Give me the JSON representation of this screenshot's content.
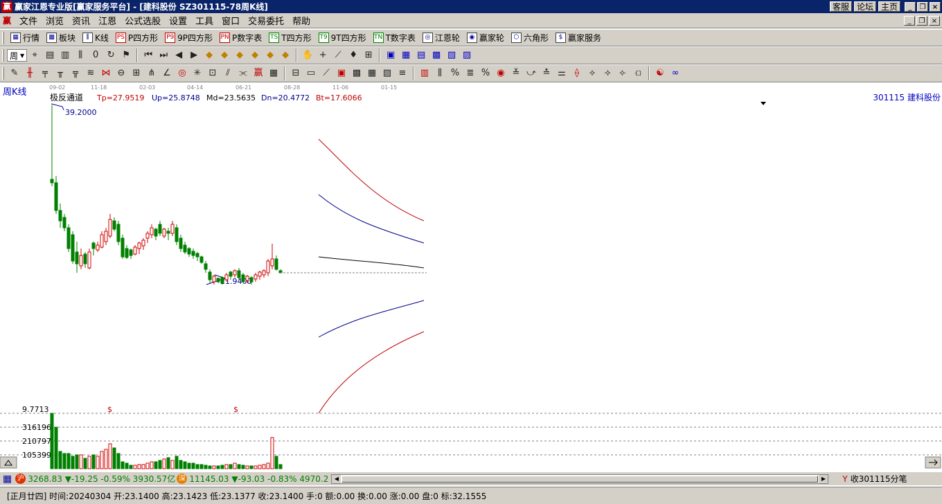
{
  "window": {
    "title": "赢家江恩专业版[赢家服务平台] - [建科股份  SZ301115-78周K线]",
    "logo": "赢",
    "links": [
      "客服",
      "论坛",
      "主页"
    ]
  },
  "menu": {
    "logo": "赢",
    "items": [
      "文件",
      "浏览",
      "资讯",
      "江恩",
      "公式选股",
      "设置",
      "工具",
      "窗口",
      "交易委托",
      "帮助"
    ]
  },
  "toolbar1": {
    "items": [
      {
        "icon": "grid-icon",
        "glyph": "▦",
        "label": "行情"
      },
      {
        "icon": "blocks-icon",
        "glyph": "▩",
        "label": "板块"
      },
      {
        "icon": "kline-icon",
        "glyph": "⫼",
        "label": "K线"
      },
      {
        "icon": "ps-icon",
        "glyph": "PS",
        "label": "P四方形"
      },
      {
        "icon": "p9-icon",
        "glyph": "P9",
        "label": "9P四方形"
      },
      {
        "icon": "pn-icon",
        "glyph": "PN",
        "label": "P数字表"
      },
      {
        "icon": "ts-icon",
        "glyph": "TS",
        "label": "T四方形"
      },
      {
        "icon": "t9-icon",
        "glyph": "T9",
        "label": "9T四方形"
      },
      {
        "icon": "tn-icon",
        "glyph": "TN",
        "label": "T数字表"
      },
      {
        "icon": "gann-wheel-icon",
        "glyph": "◎",
        "label": "江恩轮"
      },
      {
        "icon": "winner-wheel-icon",
        "glyph": "◉",
        "label": "赢家轮"
      },
      {
        "icon": "hexagon-icon",
        "glyph": "⬡",
        "label": "六角形"
      },
      {
        "icon": "dollar-icon",
        "glyph": "$",
        "label": "赢家服务"
      }
    ]
  },
  "toolbar2": {
    "period": "周",
    "icons": [
      "cursor-icon",
      "table-icon",
      "bars-icon",
      "candles-icon",
      "zero-icon",
      "rotate-icon",
      "flag-icon",
      "first-icon",
      "last-icon",
      "left-icon",
      "right-icon",
      "diamond1-icon",
      "diamond2-icon",
      "diamond3-icon",
      "diamond4-icon",
      "diamond5-icon",
      "diamond6-icon",
      "hand-icon",
      "cross-icon",
      "zigzag-icon",
      "gift-icon",
      "overlay-icon",
      "calendar-icon",
      "calc-icon",
      "doc-icon",
      "save-icon",
      "print-icon",
      "export-icon"
    ]
  },
  "toolbar3": {
    "icons": [
      "pen-icon",
      "line1-icon",
      "line2-icon",
      "line3-icon",
      "line4-icon",
      "line5-icon",
      "line6-icon",
      "circle-icon",
      "hline-icon",
      "fan-icon",
      "angle-icon",
      "spiral-icon",
      "star-icon",
      "box-icon",
      "channel-icon",
      "gann-fan-icon",
      "winner-icon",
      "grid2-icon",
      "grid3-icon",
      "rect-icon",
      "fan2-icon",
      "box2-icon",
      "box3-icon",
      "grid4-icon",
      "hatch-icon",
      "lines-icon",
      "bars2-icon",
      "fib-icon",
      "percent-icon",
      "fib2-icon",
      "pct2-icon",
      "circle2-icon",
      "fib3-icon",
      "arrow-icon",
      "fib4-icon",
      "fib5-icon",
      "fan3-icon",
      "fan4-icon",
      "fan5-icon",
      "fan6-icon",
      "fan7-icon",
      "yinyang-icon",
      "infinity-icon"
    ]
  },
  "chart": {
    "period_label": "周K线",
    "indicator": "极反通道",
    "tp": "Tp=27.9519",
    "up": "Up=25.8748",
    "md": "Md=23.5635",
    "dn": "Dn=20.4772",
    "bt": "Bt=17.6066",
    "stock": "301115  建科股份",
    "date_ticks": [
      "09-02",
      "11-18",
      "02-03",
      "04-14",
      "06-21",
      "08-28",
      "11-06",
      "01-15"
    ],
    "high_label": "39.2000",
    "low_label": "21.9400",
    "vol_labels": [
      "9.7713",
      "316196",
      "210797",
      "105399"
    ],
    "dollar_marks": [
      "$",
      "$"
    ],
    "colors": {
      "up": "#d00000",
      "down": "#008000",
      "top_band": "#c00000",
      "mid_band": "#00008b",
      "center": "#000000"
    }
  },
  "chart_data": {
    "type": "line",
    "title": "极反通道",
    "series": [
      {
        "name": "Tp",
        "values": [
          27.9519
        ]
      },
      {
        "name": "Up",
        "values": [
          25.8748
        ]
      },
      {
        "name": "Md",
        "values": [
          23.5635
        ]
      },
      {
        "name": "Dn",
        "values": [
          20.4772
        ]
      },
      {
        "name": "Bt",
        "values": [
          17.6066
        ]
      }
    ]
  },
  "status1": {
    "sh_badge": "沪",
    "sh_text1": "3268.83",
    "sh_text2": "▼-19.25 -0.59% 3930.57亿",
    "sz_badge": "深",
    "sz_text1": "11145.03",
    "sz_text2": "▼-93.03 -0.83% 4970.2",
    "right": "收301115分笔"
  },
  "status2": {
    "text": "[正月廿四] 时间:20240304 开:23.1400 高:23.1423 低:23.1377 收:23.1400 手:0 额:0.00 换:0.00 涨:0.00 盘:0 标:32.1555"
  }
}
